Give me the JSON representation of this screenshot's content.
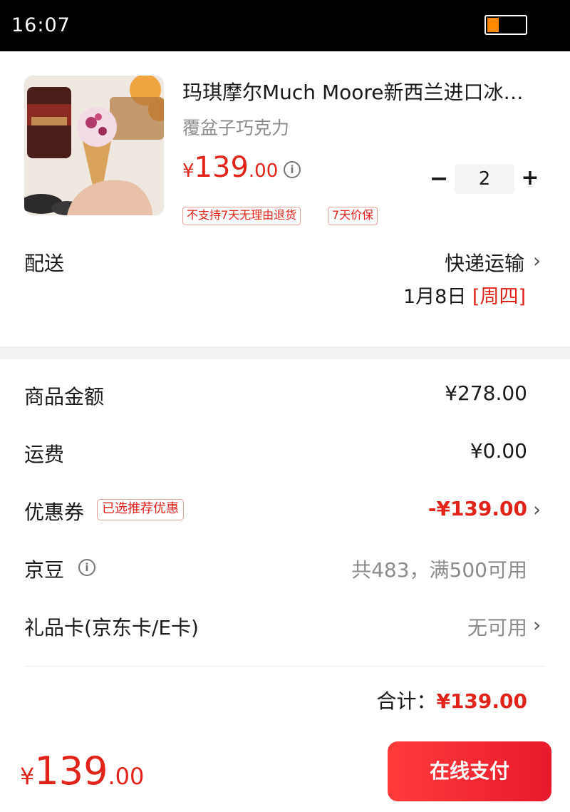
{
  "status_bar": {
    "time": "16:07",
    "battery_level": 0.3,
    "battery_color": "#ff8a00"
  },
  "product": {
    "title": "玛琪摩尔Much Moore新西兰进口冰…",
    "spec": "覆盆子巧克力",
    "price_symbol": "¥",
    "price_int": "139",
    "price_dec": ".00",
    "quantity": "2",
    "minus_label": "−",
    "plus_label": "+",
    "tags": [
      "不支持7天无理由退货",
      "7天价保"
    ],
    "image_icon": "ice-cream-product-photo"
  },
  "delivery": {
    "label": "配送",
    "method": "快递运输",
    "date": "1月8日",
    "weekday": "[周四]"
  },
  "summary": {
    "goods_label": "商品金额",
    "goods_value": "¥278.00",
    "shipping_label": "运费",
    "shipping_value": "¥0.00",
    "coupon_label": "优惠券",
    "coupon_tag": "已选推荐优惠",
    "coupon_value": "-¥139.00",
    "jd_label": "京豆",
    "jd_value": "共483，满500可用",
    "giftcard_label": "礼品卡(京东卡/E卡)",
    "giftcard_value": "无可用",
    "total_label": "合计：",
    "total_value": "¥139.00"
  },
  "footer": {
    "price_symbol": "¥",
    "price_int": "139",
    "price_dec": ".00",
    "pay_label": "在线支付"
  },
  "colors": {
    "accent": "#e2231a",
    "muted": "#8c8c8c"
  },
  "icons": {
    "chevron": "›",
    "info": "i"
  }
}
